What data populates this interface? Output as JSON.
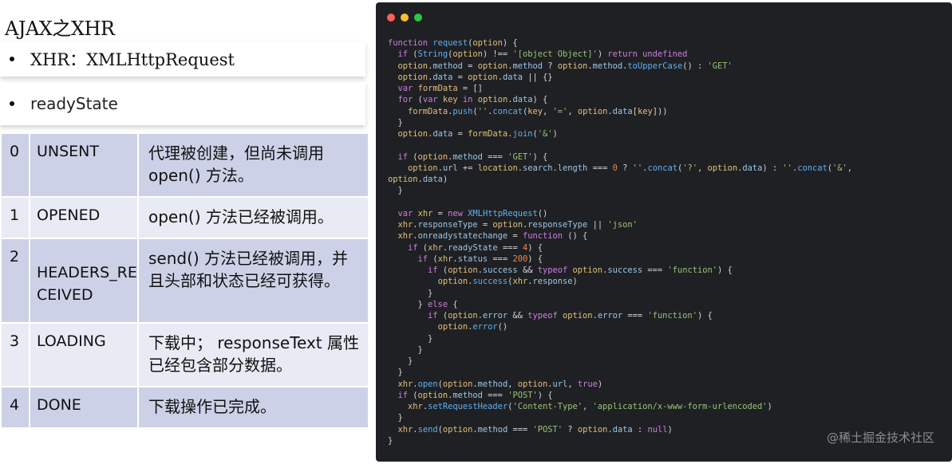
{
  "slide": {
    "title": "AJAX之XHR",
    "bullets": [
      "XHR：XMLHttpRequest",
      "readyState"
    ]
  },
  "ready_states": [
    {
      "num": "0",
      "name": "UNSENT",
      "desc": "代理被创建，但尚未调用 open() 方法。"
    },
    {
      "num": "1",
      "name": "OPENED",
      "desc": "open() 方法已经被调用。"
    },
    {
      "num": "2",
      "name": "HEADERS_RECEIVED",
      "desc": "send() 方法已经被调用，并且头部和状态已经可获得。"
    },
    {
      "num": "3",
      "name": "LOADING",
      "desc": "下载中； responseText 属性已经包含部分数据。"
    },
    {
      "num": "4",
      "name": "DONE",
      "desc": "下载操作已完成。"
    }
  ],
  "code": {
    "language": "javascript",
    "source": "function request(option) {\n  if (String(option) !== '[object Object]') return undefined\n  option.method = option.method ? option.method.toUpperCase() : 'GET'\n  option.data = option.data || {}\n  var formData = []\n  for (var key in option.data) {\n    formData.push(''.concat(key, '=', option.data[key]))\n  }\n  option.data = formData.join('&')\n\n  if (option.method === 'GET') {\n    option.url += location.search.length === 0 ? ''.concat('?', option.data) : ''.concat('&', \noption.data)\n  }\n\n  var xhr = new XMLHttpRequest()\n  xhr.responseType = option.responseType || 'json'\n  xhr.onreadystatechange = function () {\n    if (xhr.readyState === 4) {\n      if (xhr.status === 200) {\n        if (option.success && typeof option.success === 'function') {\n          option.success(xhr.response)\n        }\n      } else {\n        if (option.error && typeof option.error === 'function') {\n          option.error()\n        }\n      }\n    }\n  }\n  xhr.open(option.method, option.url, true)\n  if (option.method === 'POST') {\n    xhr.setRequestHeader('Content-Type', 'application/x-www-form-urlencoded')\n  }\n  xhr.send(option.method === 'POST' ? option.data : null)\n}"
  },
  "watermark": "@稀土掘金技术社区",
  "colors": {
    "code_background": "#1f2023",
    "table_row_dark": "#cdd1e7",
    "table_row_light": "#e8eaf4",
    "window_red": "#fe5f57",
    "window_yellow": "#febc2e",
    "window_green": "#28c840"
  }
}
